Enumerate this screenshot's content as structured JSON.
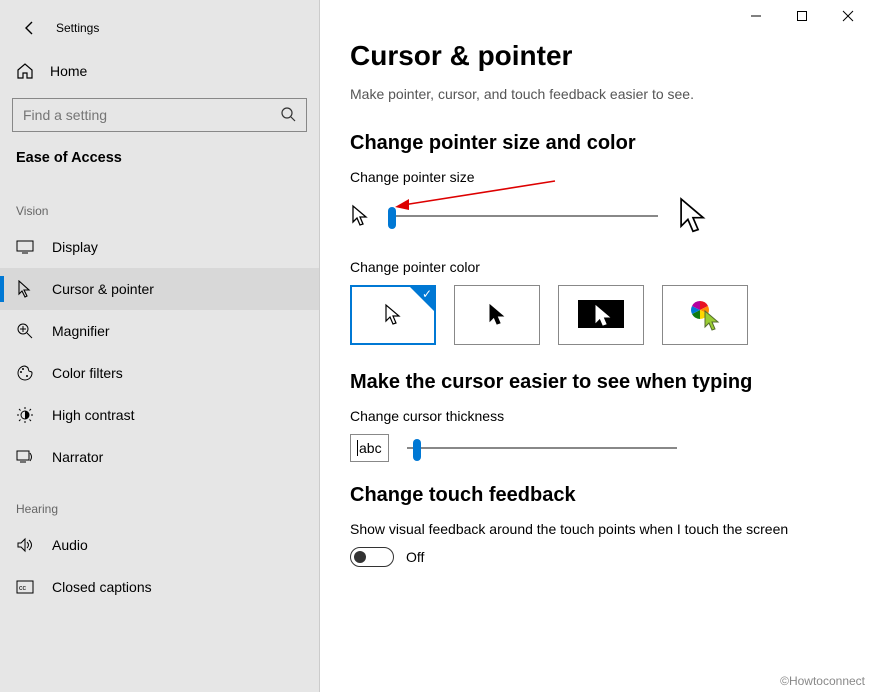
{
  "app": {
    "title": "Settings"
  },
  "sidebar": {
    "home": "Home",
    "search_placeholder": "Find a setting",
    "category": "Ease of Access",
    "groups": [
      {
        "label": "Vision",
        "items": [
          {
            "id": "display",
            "label": "Display"
          },
          {
            "id": "cursor-pointer",
            "label": "Cursor & pointer",
            "selected": true
          },
          {
            "id": "magnifier",
            "label": "Magnifier"
          },
          {
            "id": "color-filters",
            "label": "Color filters"
          },
          {
            "id": "high-contrast",
            "label": "High contrast"
          },
          {
            "id": "narrator",
            "label": "Narrator"
          }
        ]
      },
      {
        "label": "Hearing",
        "items": [
          {
            "id": "audio",
            "label": "Audio"
          },
          {
            "id": "closed-captions",
            "label": "Closed captions"
          }
        ]
      }
    ]
  },
  "main": {
    "title": "Cursor & pointer",
    "description": "Make pointer, cursor, and touch feedback easier to see.",
    "section1": {
      "heading": "Change pointer size and color",
      "size_label": "Change pointer size",
      "color_label": "Change pointer color",
      "color_options": [
        "white",
        "black",
        "inverted",
        "custom"
      ]
    },
    "section2": {
      "heading": "Make the cursor easier to see when typing",
      "thickness_label": "Change cursor thickness",
      "preview_text": "abc"
    },
    "section3": {
      "heading": "Change touch feedback",
      "toggle_label": "Show visual feedback around the touch points when I touch the screen",
      "toggle_state": "Off"
    }
  },
  "watermark": "©Howtoconnect"
}
